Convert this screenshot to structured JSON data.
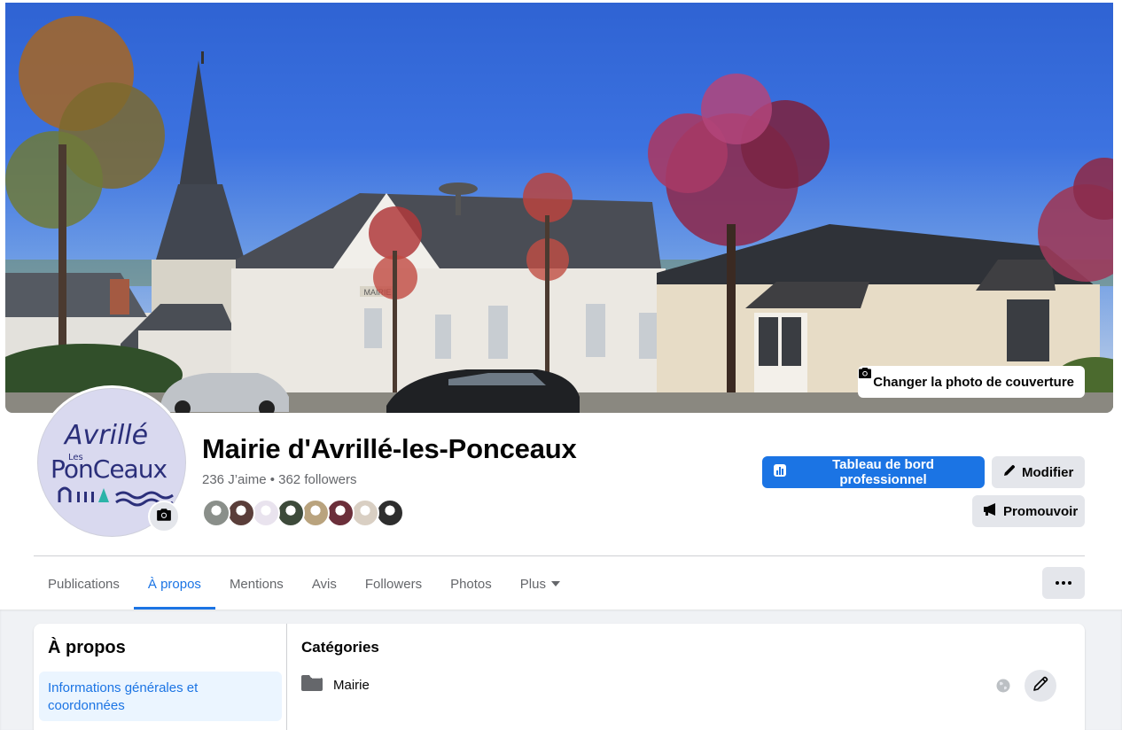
{
  "cover": {
    "change_button_label": "Changer la photo de couverture",
    "mairie_sign": "MAIRIE"
  },
  "avatar": {
    "logo_line1": "Avrillé",
    "logo_small": "Les",
    "logo_line2": "PonCeaux"
  },
  "page": {
    "name": "Mairie d'Avrillé-les-Ponceaux",
    "stats": "236 J’aime • 362 followers"
  },
  "follower_avatars": [
    {
      "color": "#8a8f8a"
    },
    {
      "color": "#5a3e3a"
    },
    {
      "color": "#e9e3ee"
    },
    {
      "color": "#3d4a3a"
    },
    {
      "color": "#b9a37e"
    },
    {
      "color": "#6b2f3a"
    },
    {
      "color": "#d9cfc3"
    },
    {
      "color": "#2e2e2e"
    }
  ],
  "actions": {
    "dashboard_label": "Tableau de bord professionnel",
    "modify_label": "Modifier",
    "promote_label": "Promouvoir"
  },
  "tabs": [
    {
      "label": "Publications",
      "active": false
    },
    {
      "label": "À propos",
      "active": true
    },
    {
      "label": "Mentions",
      "active": false
    },
    {
      "label": "Avis",
      "active": false
    },
    {
      "label": "Followers",
      "active": false
    },
    {
      "label": "Photos",
      "active": false
    },
    {
      "label": "Plus",
      "active": false
    }
  ],
  "about": {
    "title": "À propos",
    "nav_item": "Informations générales et coordonnées",
    "categories_title": "Catégories",
    "category": "Mairie"
  },
  "colors": {
    "accent": "#1b74e4",
    "secondary_text": "#65676b",
    "button_gray": "#e4e6eb",
    "page_bg": "#f0f2f5"
  },
  "icons": [
    "camera-icon",
    "dashboard-chart-icon",
    "pencil-icon",
    "megaphone-icon",
    "caret-down-icon",
    "more-dots-icon",
    "folder-icon",
    "globe-icon"
  ]
}
